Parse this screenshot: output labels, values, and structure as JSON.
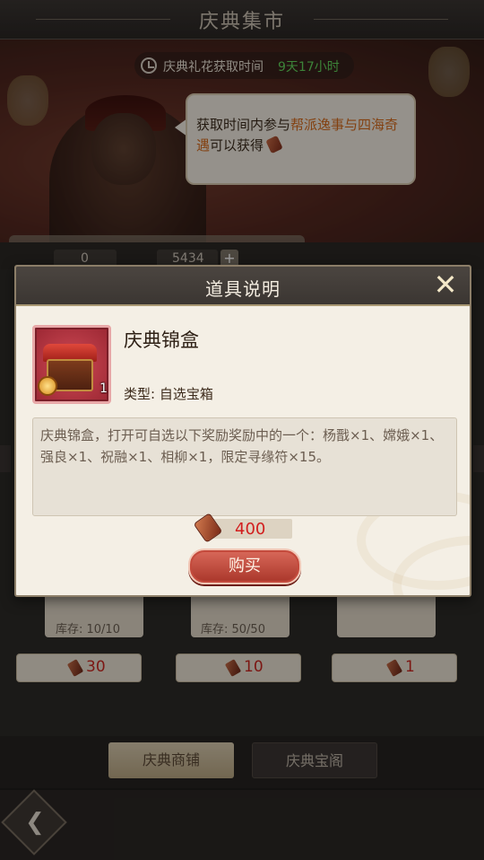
{
  "header": {
    "title": "庆典集市"
  },
  "banner": {
    "timer_label": "庆典礼花获取时间",
    "timer_value": "9天17小时",
    "speech_part1": "获取时间内参与",
    "speech_highlight": "帮派逸事与四海奇遇",
    "speech_part2": "可以获得"
  },
  "currency": {
    "first_value": "0",
    "second_value": "5434",
    "plus_label": "+"
  },
  "shop": {
    "items": [
      {
        "stock_label": "库存: 10/10",
        "price": "30"
      },
      {
        "stock_label": "库存: 50/50",
        "price": "10"
      },
      {
        "stock_label": "",
        "price": "1"
      }
    ]
  },
  "tabs": [
    {
      "label": "庆典商铺",
      "active": true
    },
    {
      "label": "庆典宝阁",
      "active": false
    }
  ],
  "modal": {
    "title": "道具说明",
    "close_icon": "close-x",
    "item_name": "庆典锦盒",
    "item_count": "1",
    "item_type": "类型: 自选宝箱",
    "description": "庆典锦盒，打开可自选以下奖励奖励中的一个：杨戬×1、嫦娥×1、强良×1、祝融×1、相柳×1，限定寻缘符×15。",
    "price": "400",
    "buy_label": "购买"
  },
  "colors": {
    "accent_red": "#d21e1e",
    "timer_green": "#61d35b",
    "highlight_orange": "#d46a1c"
  }
}
